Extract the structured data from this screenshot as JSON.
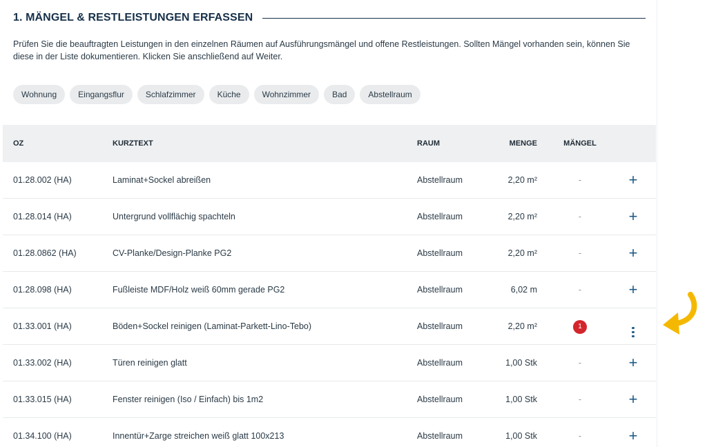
{
  "section": {
    "title": "1. Mängel & Restleistungen erfassen",
    "intro": "Prüfen Sie die beauftragten Leistungen in den einzelnen Räumen auf Ausführungsmängel und offene Restleistungen. Sollten Mängel vorhanden sein, können Sie diese in der Liste dokumentieren. Klicken Sie anschließend auf Weiter."
  },
  "rooms": [
    "Wohnung",
    "Eingangsflur",
    "Schlafzimmer",
    "Küche",
    "Wohnzimmer",
    "Bad",
    "Abstellraum"
  ],
  "table": {
    "headers": {
      "oz": "OZ",
      "kurztext": "KURZTEXT",
      "raum": "RAUM",
      "menge": "MENGE",
      "maengel": "MÄNGEL"
    },
    "rows": [
      {
        "oz": "01.28.002 (HA)",
        "kurztext": "Laminat+Sockel abreißen",
        "raum": "Abstellraum",
        "menge": "2,20 m²",
        "maengel": "-",
        "action": "plus-icon"
      },
      {
        "oz": "01.28.014 (HA)",
        "kurztext": "Untergrund vollflächig spachteln",
        "raum": "Abstellraum",
        "menge": "2,20 m²",
        "maengel": "-",
        "action": "plus-icon"
      },
      {
        "oz": "01.28.0862 (HA)",
        "kurztext": "CV-Planke/Design-Planke PG2",
        "raum": "Abstellraum",
        "menge": "2,20 m²",
        "maengel": "-",
        "action": "plus-icon"
      },
      {
        "oz": "01.28.098 (HA)",
        "kurztext": "Fußleiste MDF/Holz weiß 60mm gerade PG2",
        "raum": "Abstellraum",
        "menge": "6,02 m",
        "maengel": "-",
        "action": "plus-icon"
      },
      {
        "oz": "01.33.001 (HA)",
        "kurztext": "Böden+Sockel reinigen (Laminat-Parkett-Lino-Tebo)",
        "raum": "Abstellraum",
        "menge": "2,20 m²",
        "maengel": "1",
        "action": "more-vertical-icon"
      },
      {
        "oz": "01.33.002 (HA)",
        "kurztext": "Türen reinigen glatt",
        "raum": "Abstellraum",
        "menge": "1,00 Stk",
        "maengel": "-",
        "action": "plus-icon"
      },
      {
        "oz": "01.33.015 (HA)",
        "kurztext": "Fenster reinigen (Iso / Einfach) bis 1m2",
        "raum": "Abstellraum",
        "menge": "1,00 Stk",
        "maengel": "-",
        "action": "plus-icon"
      },
      {
        "oz": "01.34.100 (HA)",
        "kurztext": "Innentür+Zarge streichen weiß glatt 100x213",
        "raum": "Abstellraum",
        "menge": "1,00 Stk",
        "maengel": "-",
        "action": "plus-icon"
      }
    ]
  },
  "colors": {
    "accent": "#1e5a86",
    "badge": "#d3262c",
    "arrow": "#f5b800",
    "header_bg": "#eff0f1"
  },
  "icons": {
    "add": "plus-icon",
    "more": "more-vertical-icon",
    "pointer": "curved-arrow-icon"
  }
}
